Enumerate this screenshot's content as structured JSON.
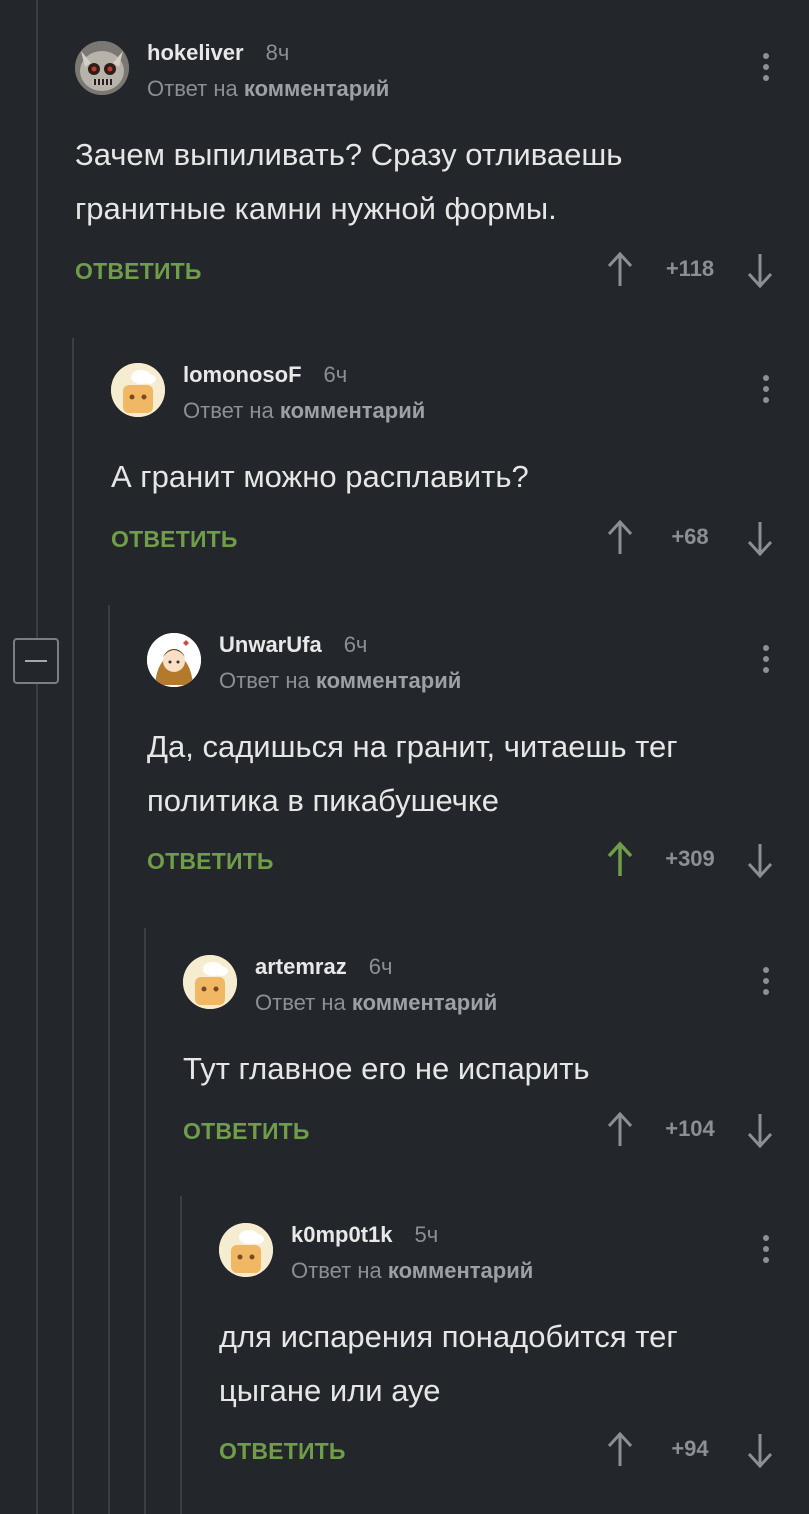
{
  "colors": {
    "accent_green": "#6f9d49",
    "muted": "#8b9096",
    "background": "#23262a"
  },
  "comments": [
    {
      "username": "hokeliver",
      "time": "8ч",
      "reply_prefix": "Ответ на",
      "reply_target": "комментарий",
      "text": "Зачем выпиливать? Сразу отливаешь гранитные камни нужной формы.",
      "reply_label": "ОТВЕТИТЬ",
      "score": "+118",
      "upvoted": false,
      "avatar": "owl-avatar"
    },
    {
      "username": "lomonosoF",
      "time": "6ч",
      "reply_prefix": "Ответ на",
      "reply_target": "комментарий",
      "text": "А гранит можно расплавить?",
      "reply_label": "ОТВЕТИТЬ",
      "score": "+68",
      "upvoted": false,
      "avatar": "default-avatar"
    },
    {
      "username": "UnwarUfa",
      "time": "6ч",
      "reply_prefix": "Ответ на",
      "reply_target": "комментарий",
      "text": "Да, садишься на гранит, читаешь тег политика в пикабушечке",
      "reply_label": "ОТВЕТИТЬ",
      "score": "+309",
      "upvoted": true,
      "avatar": "girl-avatar"
    },
    {
      "username": "artemraz",
      "time": "6ч",
      "reply_prefix": "Ответ на",
      "reply_target": "комментарий",
      "text": "Тут главное его не испарить",
      "reply_label": "ОТВЕТИТЬ",
      "score": "+104",
      "upvoted": false,
      "avatar": "default-avatar"
    },
    {
      "username": "k0mp0t1k",
      "time": "5ч",
      "reply_prefix": "Ответ на",
      "reply_target": "комментарий",
      "text": "для испарения понадобится тег цыгане или ауе",
      "reply_label": "ОТВЕТИТЬ",
      "score": "+94",
      "upvoted": false,
      "avatar": "default-avatar"
    }
  ]
}
